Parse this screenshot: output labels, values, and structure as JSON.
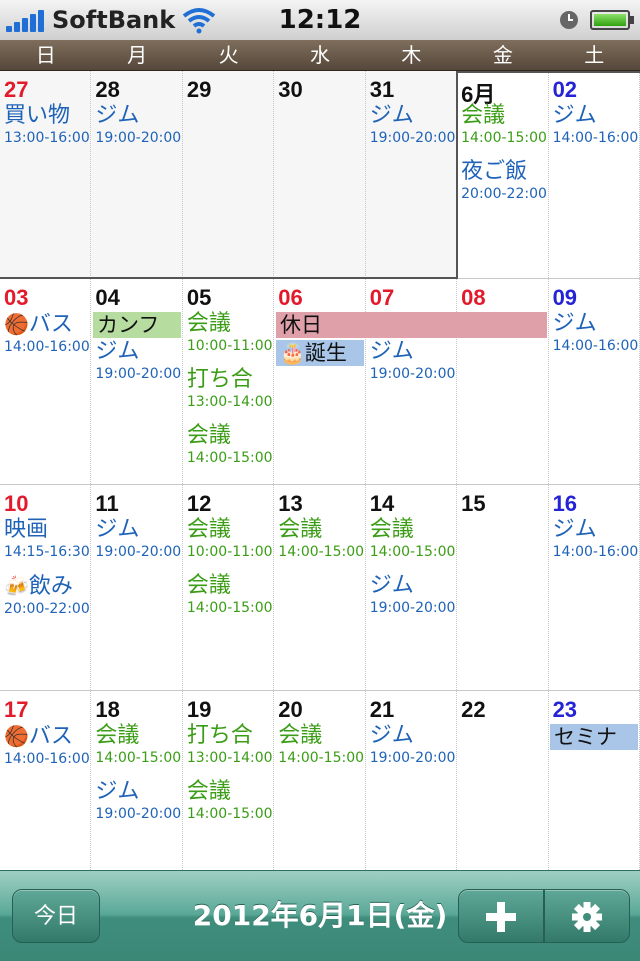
{
  "status": {
    "carrier": "SoftBank",
    "time": "12:12"
  },
  "weekdays": [
    "日",
    "月",
    "火",
    "水",
    "木",
    "金",
    "土"
  ],
  "toolbar": {
    "today_label": "今日",
    "title": "2012年6月1日(金)"
  },
  "weeks": [
    [
      {
        "day": "27",
        "color": "red",
        "other": true,
        "events": [
          {
            "t": "買い物",
            "tm": "13:00-16:00",
            "c": "blue"
          }
        ]
      },
      {
        "day": "28",
        "color": "black",
        "other": true,
        "events": [
          {
            "t": "ジム",
            "tm": "19:00-20:00",
            "c": "blue"
          }
        ]
      },
      {
        "day": "29",
        "color": "black",
        "other": true,
        "events": []
      },
      {
        "day": "30",
        "color": "black",
        "other": true,
        "events": []
      },
      {
        "day": "31",
        "color": "black",
        "other": true,
        "events": [
          {
            "t": "ジム",
            "tm": "19:00-20:00",
            "c": "blue"
          }
        ]
      },
      {
        "day": "6月",
        "color": "black",
        "other": false,
        "events": [
          {
            "t": "会議",
            "tm": "14:00-15:00",
            "c": "green"
          },
          {
            "t": "夜ご飯",
            "tm": "20:00-22:00",
            "c": "blue"
          }
        ]
      },
      {
        "day": "02",
        "color": "blue",
        "other": false,
        "events": [
          {
            "t": "ジム",
            "tm": "14:00-16:00",
            "c": "blue"
          }
        ]
      }
    ],
    [
      {
        "day": "03",
        "color": "red",
        "events": [
          {
            "t": "バス",
            "tm": "14:00-16:00",
            "c": "blue",
            "icon": "🏀"
          }
        ]
      },
      {
        "day": "04",
        "color": "black",
        "events": [
          {
            "t": "ジム",
            "tm": "19:00-20:00",
            "c": "blue",
            "slot": 1
          }
        ]
      },
      {
        "day": "05",
        "color": "black",
        "events": [
          {
            "t": "会議",
            "tm": "10:00-11:00",
            "c": "green"
          },
          {
            "t": "打ち合",
            "tm": "13:00-14:00",
            "c": "green"
          },
          {
            "t": "会議",
            "tm": "14:00-15:00",
            "c": "green"
          }
        ]
      },
      {
        "day": "06",
        "color": "red",
        "events": []
      },
      {
        "day": "07",
        "color": "red",
        "events": [
          {
            "t": "ジム",
            "tm": "19:00-20:00",
            "c": "blue",
            "slot": 1
          }
        ]
      },
      {
        "day": "08",
        "color": "red",
        "events": []
      },
      {
        "day": "09",
        "color": "blue",
        "events": [
          {
            "t": "ジム",
            "tm": "14:00-16:00",
            "c": "blue"
          }
        ]
      }
    ],
    [
      {
        "day": "10",
        "color": "red",
        "events": [
          {
            "t": "映画",
            "tm": "14:15-16:30",
            "c": "blue"
          },
          {
            "t": "飲み",
            "tm": "20:00-22:00",
            "c": "blue",
            "icon": "🍻"
          }
        ]
      },
      {
        "day": "11",
        "color": "black",
        "events": [
          {
            "t": "ジム",
            "tm": "19:00-20:00",
            "c": "blue"
          }
        ]
      },
      {
        "day": "12",
        "color": "black",
        "events": [
          {
            "t": "会議",
            "tm": "10:00-11:00",
            "c": "green"
          },
          {
            "t": "会議",
            "tm": "14:00-15:00",
            "c": "green"
          }
        ]
      },
      {
        "day": "13",
        "color": "black",
        "events": [
          {
            "t": "会議",
            "tm": "14:00-15:00",
            "c": "green"
          }
        ]
      },
      {
        "day": "14",
        "color": "black",
        "events": [
          {
            "t": "会議",
            "tm": "14:00-15:00",
            "c": "green"
          },
          {
            "t": "ジム",
            "tm": "19:00-20:00",
            "c": "blue"
          }
        ]
      },
      {
        "day": "15",
        "color": "black",
        "events": []
      },
      {
        "day": "16",
        "color": "blue",
        "events": [
          {
            "t": "ジム",
            "tm": "14:00-16:00",
            "c": "blue"
          }
        ]
      }
    ],
    [
      {
        "day": "17",
        "color": "red",
        "events": [
          {
            "t": "バス",
            "tm": "14:00-16:00",
            "c": "blue",
            "icon": "🏀"
          }
        ]
      },
      {
        "day": "18",
        "color": "black",
        "events": [
          {
            "t": "会議",
            "tm": "14:00-15:00",
            "c": "green"
          },
          {
            "t": "ジム",
            "tm": "19:00-20:00",
            "c": "blue"
          }
        ]
      },
      {
        "day": "19",
        "color": "black",
        "events": [
          {
            "t": "打ち合",
            "tm": "13:00-14:00",
            "c": "green"
          },
          {
            "t": "会議",
            "tm": "14:00-15:00",
            "c": "green"
          }
        ]
      },
      {
        "day": "20",
        "color": "black",
        "events": [
          {
            "t": "会議",
            "tm": "14:00-15:00",
            "c": "green"
          }
        ]
      },
      {
        "day": "21",
        "color": "black",
        "events": [
          {
            "t": "ジム",
            "tm": "19:00-20:00",
            "c": "blue"
          }
        ]
      },
      {
        "day": "22",
        "color": "black",
        "events": []
      },
      {
        "day": "23",
        "color": "blue",
        "events": []
      }
    ]
  ],
  "bars": {
    "conf": {
      "label": "カンフ",
      "color": "#b6dca0"
    },
    "holiday": {
      "label": "休日",
      "color": "#e0a0aa"
    },
    "birthday": {
      "label": "誕生",
      "icon": "🎂",
      "color": "#a9c6e8"
    },
    "seminar": {
      "label": "セミナ",
      "color": "#a9c6e8"
    }
  }
}
